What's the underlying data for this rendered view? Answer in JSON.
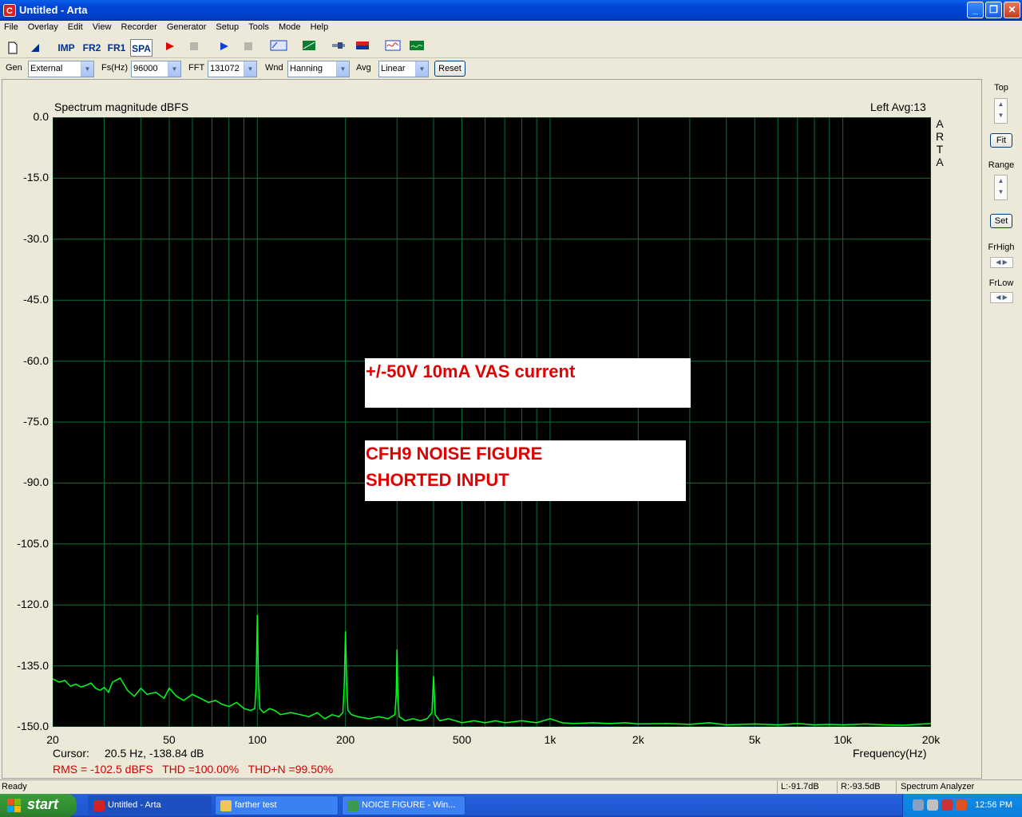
{
  "window": {
    "title": "Untitled - Arta"
  },
  "menu": [
    "File",
    "Overlay",
    "Edit",
    "View",
    "Recorder",
    "Generator",
    "Setup",
    "Tools",
    "Mode",
    "Help"
  ],
  "toolbar": {
    "imp": "IMP",
    "fr2": "FR2",
    "fr1": "FR1",
    "spa": "SPA"
  },
  "controls": {
    "gen_label": "Gen",
    "gen_value": "External",
    "fs_label": "Fs(Hz)",
    "fs_value": "96000",
    "fft_label": "FFT",
    "fft_value": "131072",
    "wnd_label": "Wnd",
    "wnd_value": "Hanning",
    "avg_label": "Avg",
    "avg_value": "Linear",
    "reset": "Reset"
  },
  "graph": {
    "title": "Spectrum magnitude dBFS",
    "channel_info": "Left  Avg:13",
    "watermark": "ARTA",
    "xlabel": "Frequency(Hz)",
    "cursor_label": "Cursor:",
    "cursor_value": "20.5 Hz, -138.84 dB",
    "stats": "RMS = -102.5 dBFS   THD =100.00%   THD+N =99.50%",
    "annotation1": "+/-50V 10mA VAS current",
    "annotation2_line1": "CFH9 NOISE FIGURE",
    "annotation2_line2": "SHORTED INPUT"
  },
  "right_panel": {
    "top": "Top",
    "fit": "Fit",
    "range": "Range",
    "set": "Set",
    "frhigh": "FrHigh",
    "frlow": "FrLow"
  },
  "status": {
    "ready": "Ready",
    "left_level": "L:-91.7dB",
    "right_level": "R:-93.5dB",
    "mode": "Spectrum Analyzer"
  },
  "taskbar": {
    "start": "start",
    "tasks": [
      "Untitled - Arta",
      "farther test",
      "NOICE FIGURE - Win..."
    ],
    "clock": "12:56 PM"
  },
  "colors": {
    "trace": "#00ff1a",
    "grid": "#0a6e3a",
    "plot_bg": "#000000",
    "annotation": "#e00000"
  },
  "chart_data": {
    "type": "line",
    "title": "Spectrum magnitude dBFS",
    "xlabel": "Frequency(Hz)",
    "ylabel": "",
    "x_scale": "log",
    "xlim": [
      20,
      20000
    ],
    "ylim": [
      -150,
      0
    ],
    "x_ticks": [
      20,
      50,
      100,
      200,
      500,
      1000,
      2000,
      5000,
      10000,
      20000
    ],
    "x_tick_labels": [
      "20",
      "50",
      "100",
      "200",
      "500",
      "1k",
      "2k",
      "5k",
      "10k",
      "20k"
    ],
    "y_ticks": [
      0,
      -15,
      -30,
      -45,
      -60,
      -75,
      -90,
      -105,
      -120,
      -135,
      -150
    ],
    "y_tick_labels": [
      "0.0",
      "-15.0",
      "-30.0",
      "-45.0",
      "-60.0",
      "-75.0",
      "-90.0",
      "-105.0",
      "-120.0",
      "-135.0",
      "-150.0"
    ],
    "grid": true,
    "series": [
      {
        "x": [
          20,
          21,
          22,
          23,
          24,
          25,
          26,
          27,
          28,
          29,
          30,
          31,
          32,
          34,
          36,
          38,
          40,
          42,
          45,
          48,
          50,
          53,
          56,
          60,
          64,
          68,
          72,
          76,
          80,
          85,
          90,
          95,
          98,
          99,
          100,
          101,
          102,
          105,
          110,
          115,
          120,
          130,
          140,
          150,
          160,
          170,
          180,
          190,
          196,
          198,
          200,
          202,
          204,
          210,
          220,
          240,
          260,
          280,
          295,
          298,
          300,
          302,
          305,
          320,
          340,
          360,
          380,
          395,
          398,
          400,
          402,
          405,
          420,
          450,
          500,
          550,
          600,
          650,
          700,
          800,
          900,
          1000,
          1100,
          1200,
          1400,
          1600,
          1800,
          2000,
          2500,
          3000,
          3500,
          4000,
          5000,
          6000,
          7000,
          8000,
          9000,
          10000,
          12000,
          14000,
          16000,
          18000,
          20000
        ],
        "y": [
          -138.2,
          -139,
          -138.6,
          -140,
          -139.5,
          -140.2,
          -139.8,
          -139.2,
          -140.5,
          -141,
          -140.3,
          -141.5,
          -139,
          -138,
          -141,
          -142.5,
          -140.5,
          -142,
          -141.5,
          -143,
          -140.5,
          -142.5,
          -143.5,
          -142,
          -143,
          -144,
          -143.5,
          -144.5,
          -145,
          -144,
          -145.5,
          -146,
          -145.5,
          -140,
          -122.5,
          -140,
          -145.5,
          -146.5,
          -145.5,
          -146,
          -147,
          -146.5,
          -147,
          -147.5,
          -146.5,
          -148,
          -147,
          -147.5,
          -146.5,
          -140,
          -126.5,
          -140,
          -146,
          -147,
          -147.5,
          -148,
          -147.5,
          -148,
          -147,
          -142,
          -131,
          -142,
          -147.5,
          -148.5,
          -148,
          -148.5,
          -148,
          -146.5,
          -141,
          -137.5,
          -141,
          -147,
          -148.5,
          -148,
          -149,
          -148.5,
          -149,
          -148.5,
          -149,
          -148.5,
          -149,
          -148,
          -149,
          -149.2,
          -149,
          -149.2,
          -149,
          -149.3,
          -149.2,
          -149.4,
          -149,
          -149.5,
          -149.3,
          -149.5,
          -149.2,
          -149.5,
          -149.4,
          -149.5,
          -149.3,
          -149.5,
          -149.6,
          -149.4,
          -149.2
        ]
      }
    ]
  }
}
